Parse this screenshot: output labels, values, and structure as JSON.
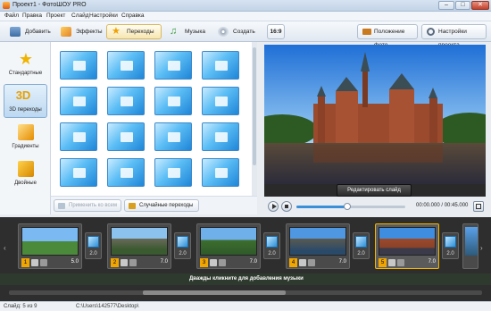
{
  "window": {
    "title": "Проект1 - ФотоШОУ PRO",
    "minimize": "–",
    "maximize": "□",
    "close": "✕"
  },
  "menu": [
    "Файл",
    "Правка",
    "Проект",
    "Слайд",
    "Настройки",
    "Справка"
  ],
  "tabs": [
    {
      "label": "Добавить",
      "icon": "add-photos-icon"
    },
    {
      "label": "Эффекты",
      "icon": "effects-icon"
    },
    {
      "label": "Переходы",
      "icon": "transitions-star-icon",
      "active": true
    },
    {
      "label": "Музыка",
      "icon": "music-note-icon"
    },
    {
      "label": "Создать",
      "icon": "create-disc-icon"
    }
  ],
  "aspect_ratio": "16:9",
  "photo_position_label": "Положение фото",
  "project_settings_label": "Настройки проекта",
  "categories": [
    {
      "label": "Стандартные",
      "icon": "star-icon"
    },
    {
      "label": "3D переходы",
      "icon": "3d-icon",
      "active": true
    },
    {
      "label": "Градиенты",
      "icon": "gradient-icon"
    },
    {
      "label": "Двойные",
      "icon": "double-icon"
    }
  ],
  "threed_label": "3D",
  "transition_tiles_count": 16,
  "apply_all_label": "Применить ко всем",
  "random_transitions_label": "Случайные переходы",
  "edit_slide_label": "Редактировать слайд",
  "player": {
    "time": "00:00.000 / 00:45.000",
    "progress": 0.47
  },
  "slides": [
    {
      "num": "1",
      "duration": "5.0"
    },
    {
      "num": "2",
      "duration": "7.0"
    },
    {
      "num": "3",
      "duration": "7.0"
    },
    {
      "num": "4",
      "duration": "7.0"
    },
    {
      "num": "5",
      "duration": "7.0",
      "selected": true
    }
  ],
  "transitions": [
    {
      "duration": "2.0"
    },
    {
      "duration": "2.0"
    },
    {
      "duration": "2.0"
    },
    {
      "duration": "2.0"
    },
    {
      "duration": "2.0"
    }
  ],
  "music_hint": "Дважды кликните для добавления музыки",
  "status": {
    "slide_info": "Слайд: 5 из 9",
    "path": "C:\\Users\\142577\\Desktop\\"
  },
  "colors": {
    "accent": "#f5b800",
    "tile": "#3c9ae0",
    "timeline_bg": "#2e2e2e"
  }
}
